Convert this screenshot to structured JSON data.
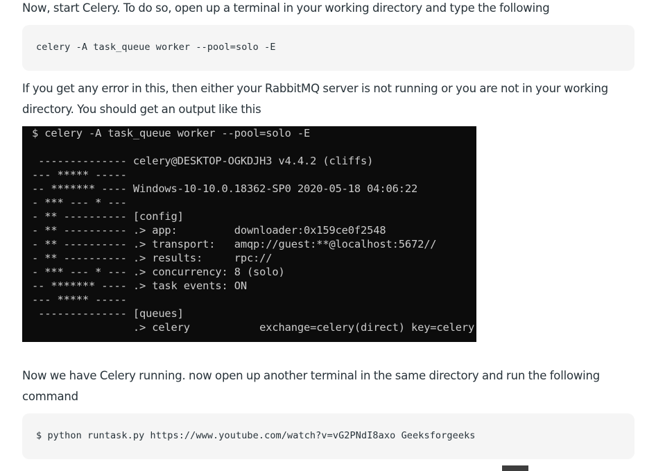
{
  "article": {
    "para1": "Now, start Celery. To do so, open up a terminal in your working directory and type the following",
    "code1": "celery -A task_queue worker --pool=solo -E",
    "para2": "If you get any error in this, then either your RabbitMQ server is not running or you are not in your working directory. You should get an output like this",
    "para3": "Now we have Celery running. now open up another terminal in the same directory and run the following command",
    "code2": "$ python runtask.py https://www.youtube.com/watch?v=vG2PNdI8axo Geeksforgeeks"
  },
  "terminal": {
    "lines": [
      "$ celery -A task_queue worker --pool=solo -E",
      "",
      " -------------- celery@DESKTOP-OGKDJH3 v4.4.2 (cliffs)",
      "--- ***** -----",
      "-- ******* ---- Windows-10-10.0.18362-SP0 2020-05-18 04:06:22",
      "- *** --- * ---",
      "- ** ---------- [config]",
      "- ** ---------- .> app:         downloader:0x159ce0f2548",
      "- ** ---------- .> transport:   amqp://guest:**@localhost:5672//",
      "- ** ---------- .> results:     rpc://",
      "- *** --- * --- .> concurrency: 8 (solo)",
      "-- ******* ---- .> task events: ON",
      "--- ***** -----",
      " -------------- [queues]",
      "                .> celery           exchange=celery(direct) key=celery"
    ]
  },
  "colors": {
    "text": "#273239",
    "code_bg": "#f5f5f5",
    "terminal_bg": "#0c0c0c",
    "terminal_text": "#cccccc"
  }
}
